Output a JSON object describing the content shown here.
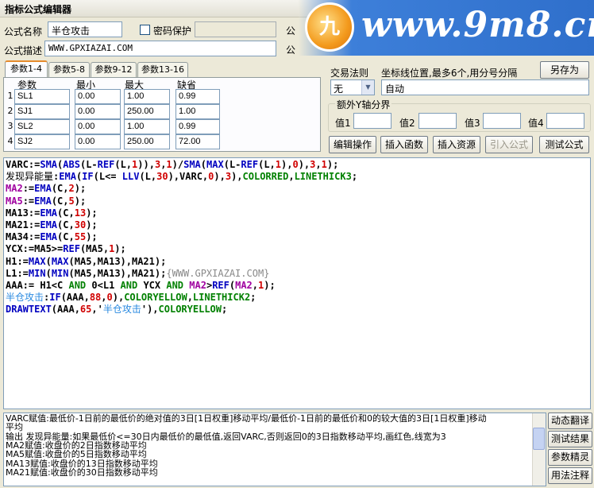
{
  "window": {
    "title": "指标公式编辑器"
  },
  "watermark": {
    "text": "www.9m8.cn",
    "badge_char": "九"
  },
  "form": {
    "name_label": "公式名称",
    "name_value": "半仓攻击",
    "password_label": "密码保护",
    "desc_label": "公式描述",
    "desc_value": "WWW.GPXIAZAI.COM",
    "partial_label_1": "公",
    "partial_label_2": "公"
  },
  "tabs": [
    "参数1-4",
    "参数5-8",
    "参数9-12",
    "参数13-16"
  ],
  "params": {
    "headers": [
      "参数",
      "最小",
      "最大",
      "缺省"
    ],
    "rows": [
      {
        "num": "1",
        "name": "SL1",
        "min": "0.00",
        "max": "1.00",
        "default": "0.99"
      },
      {
        "num": "2",
        "name": "SJ1",
        "min": "0.00",
        "max": "250.00",
        "default": "1.00"
      },
      {
        "num": "3",
        "name": "SL2",
        "min": "0.00",
        "max": "1.00",
        "default": "0.99"
      },
      {
        "num": "4",
        "name": "SJ2",
        "min": "0.00",
        "max": "250.00",
        "default": "72.00"
      }
    ]
  },
  "right_panel": {
    "save_as": "另存为",
    "trade_rule_label": "交易法则",
    "trade_rule_value": "无",
    "coord_label": "坐标线位置,最多6个,用分号分隔",
    "coord_value": "自动",
    "extra_y_label": "额外Y轴分界",
    "value_labels": [
      "值1",
      "值2",
      "值3",
      "值4"
    ]
  },
  "toolbar": [
    "编辑操作",
    "插入函数",
    "插入资源",
    "引入公式",
    "测试公式"
  ],
  "code_lines": [
    [
      [
        "VARC:=",
        "c-black"
      ],
      [
        "SMA",
        "c-blue"
      ],
      [
        "(",
        "c-black"
      ],
      [
        "ABS",
        "c-blue"
      ],
      [
        "(L-",
        "c-black"
      ],
      [
        "REF",
        "c-blue"
      ],
      [
        "(L,",
        "c-black"
      ],
      [
        "1",
        "c-red"
      ],
      [
        ")),",
        "c-black"
      ],
      [
        "3",
        "c-red"
      ],
      [
        ",",
        "c-black"
      ],
      [
        "1",
        "c-red"
      ],
      [
        ")/",
        "c-black"
      ],
      [
        "SMA",
        "c-blue"
      ],
      [
        "(",
        "c-black"
      ],
      [
        "MAX",
        "c-blue"
      ],
      [
        "(L-",
        "c-black"
      ],
      [
        "REF",
        "c-blue"
      ],
      [
        "(L,",
        "c-black"
      ],
      [
        "1",
        "c-red"
      ],
      [
        "),",
        "c-black"
      ],
      [
        "0",
        "c-red"
      ],
      [
        "),",
        "c-black"
      ],
      [
        "3",
        "c-red"
      ],
      [
        ",",
        "c-black"
      ],
      [
        "1",
        "c-red"
      ],
      [
        ");",
        "c-black"
      ]
    ],
    [
      [
        "发现异能量",
        "c-black c-cn"
      ],
      [
        ":",
        "c-black"
      ],
      [
        "EMA",
        "c-blue"
      ],
      [
        "(",
        "c-black"
      ],
      [
        "IF",
        "c-blue"
      ],
      [
        "(L<= ",
        "c-black"
      ],
      [
        "LLV",
        "c-blue"
      ],
      [
        "(L,",
        "c-black"
      ],
      [
        "30",
        "c-red"
      ],
      [
        "),VARC,",
        "c-black"
      ],
      [
        "0",
        "c-red"
      ],
      [
        "),",
        "c-black"
      ],
      [
        "3",
        "c-red"
      ],
      [
        "),",
        "c-black"
      ],
      [
        "COLORRED",
        "c-green"
      ],
      [
        ",",
        "c-black"
      ],
      [
        "LINETHICK3",
        "c-green"
      ],
      [
        ";",
        "c-black"
      ]
    ],
    [
      [
        "MA2",
        "c-magenta"
      ],
      [
        ":=",
        "c-black"
      ],
      [
        "EMA",
        "c-blue"
      ],
      [
        "(C,",
        "c-black"
      ],
      [
        "2",
        "c-red"
      ],
      [
        ");",
        "c-black"
      ]
    ],
    [
      [
        "MA5",
        "c-magenta"
      ],
      [
        ":=",
        "c-black"
      ],
      [
        "EMA",
        "c-blue"
      ],
      [
        "(C,",
        "c-black"
      ],
      [
        "5",
        "c-red"
      ],
      [
        ");",
        "c-black"
      ]
    ],
    [
      [
        "MA13:=",
        "c-black"
      ],
      [
        "EMA",
        "c-blue"
      ],
      [
        "(C,",
        "c-black"
      ],
      [
        "13",
        "c-red"
      ],
      [
        ");",
        "c-black"
      ]
    ],
    [
      [
        "MA21:=",
        "c-black"
      ],
      [
        "EMA",
        "c-blue"
      ],
      [
        "(C,",
        "c-black"
      ],
      [
        "30",
        "c-red"
      ],
      [
        ");",
        "c-black"
      ]
    ],
    [
      [
        "MA34:=",
        "c-black"
      ],
      [
        "EMA",
        "c-blue"
      ],
      [
        "(C,",
        "c-black"
      ],
      [
        "55",
        "c-red"
      ],
      [
        ");",
        "c-black"
      ]
    ],
    [
      [
        "YCX:=MA5>=",
        "c-black"
      ],
      [
        "REF",
        "c-blue"
      ],
      [
        "(MA5,",
        "c-black"
      ],
      [
        "1",
        "c-red"
      ],
      [
        ");",
        "c-black"
      ]
    ],
    [
      [
        "H1:=",
        "c-black"
      ],
      [
        "MAX",
        "c-blue"
      ],
      [
        "(",
        "c-black"
      ],
      [
        "MAX",
        "c-blue"
      ],
      [
        "(MA5,MA13),MA21);",
        "c-black"
      ]
    ],
    [
      [
        "L1:=",
        "c-black"
      ],
      [
        "MIN",
        "c-blue"
      ],
      [
        "(",
        "c-black"
      ],
      [
        "MIN",
        "c-blue"
      ],
      [
        "(MA5,MA13),MA21);",
        "c-black"
      ],
      [
        "{WWW.GPXIAZAI.COM}",
        "c-gray"
      ]
    ],
    [
      [
        "AAA:= H1<C ",
        "c-black"
      ],
      [
        "AND",
        "c-green"
      ],
      [
        " 0<L1 ",
        "c-black"
      ],
      [
        "AND",
        "c-green"
      ],
      [
        " YCX ",
        "c-black"
      ],
      [
        "AND",
        "c-green"
      ],
      [
        " ",
        "c-black"
      ],
      [
        "MA2",
        "c-magenta"
      ],
      [
        ">",
        "c-black"
      ],
      [
        "REF",
        "c-blue"
      ],
      [
        "(",
        "c-black"
      ],
      [
        "MA2",
        "c-magenta"
      ],
      [
        ",",
        "c-black"
      ],
      [
        "1",
        "c-red"
      ],
      [
        ");",
        "c-black"
      ]
    ],
    [
      [
        "半仓攻击",
        "c-lightblue c-cn"
      ],
      [
        ":",
        "c-black"
      ],
      [
        "IF",
        "c-blue"
      ],
      [
        "(AAA,",
        "c-black"
      ],
      [
        "88",
        "c-red"
      ],
      [
        ",",
        "c-black"
      ],
      [
        "0",
        "c-red"
      ],
      [
        "),",
        "c-black"
      ],
      [
        "COLORYELLOW",
        "c-green"
      ],
      [
        ",",
        "c-black"
      ],
      [
        "LINETHICK2",
        "c-green"
      ],
      [
        ";",
        "c-black"
      ]
    ],
    [
      [
        "DRAWTEXT",
        "c-blue"
      ],
      [
        "(AAA,",
        "c-black"
      ],
      [
        "65",
        "c-red"
      ],
      [
        ",'",
        "c-black"
      ],
      [
        "半仓攻击",
        "c-lightblue c-cn"
      ],
      [
        "'),",
        "c-black"
      ],
      [
        "COLORYELLOW",
        "c-green"
      ],
      [
        ";",
        "c-black"
      ]
    ]
  ],
  "output_lines": [
    "VARC赋值:最低价-1日前的最低价的绝对值的3日[1日权重]移动平均/最低价-1日前的最低价和0的较大值的3日[1日权重]移动",
    "平均",
    "输出 发现异能量:如果最低价<=30日内最低价的最低值,返回VARC,否则返回0的3日指数移动平均,画红色,线宽为3",
    "MA2赋值:收盘价的2日指数移动平均",
    "MA5赋值:收盘价的5日指数移动平均",
    "MA13赋值:收盘价的13日指数移动平均",
    "MA21赋值:收盘价的30日指数移动平均"
  ],
  "side_buttons": [
    "动态翻译",
    "测试结果",
    "参数精灵",
    "用法注释"
  ]
}
